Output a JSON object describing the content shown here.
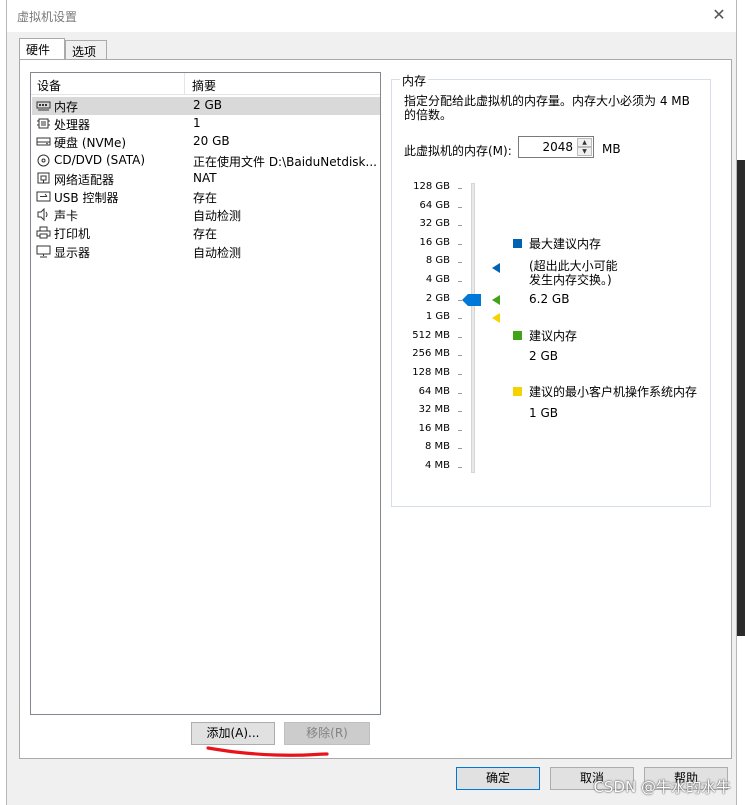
{
  "window": {
    "title": "虚拟机设置",
    "close_glyph": "✕"
  },
  "tabs": [
    {
      "label": "硬件"
    },
    {
      "label": "选项"
    }
  ],
  "device_list": {
    "headers": {
      "device": "设备",
      "summary": "摘要"
    },
    "rows": [
      {
        "name": "内存",
        "summary": "2 GB",
        "icon": "memory-icon",
        "selected": true
      },
      {
        "name": "处理器",
        "summary": "1",
        "icon": "cpu-icon"
      },
      {
        "name": "硬盘 (NVMe)",
        "summary": "20 GB",
        "icon": "hard-disk-icon"
      },
      {
        "name": "CD/DVD (SATA)",
        "summary": "正在使用文件 D:\\BaiduNetdisk...",
        "icon": "cd-dvd-icon"
      },
      {
        "name": "网络适配器",
        "summary": "NAT",
        "icon": "network-adapter-icon"
      },
      {
        "name": "USB 控制器",
        "summary": "存在",
        "icon": "usb-icon"
      },
      {
        "name": "声卡",
        "summary": "自动检测",
        "icon": "speaker-icon"
      },
      {
        "name": "打印机",
        "summary": "存在",
        "icon": "printer-icon"
      },
      {
        "name": "显示器",
        "summary": "自动检测",
        "icon": "monitor-icon"
      }
    ]
  },
  "buttons": {
    "add": "添加(A)...",
    "remove": "移除(R)",
    "ok": "确定",
    "cancel": "取消",
    "help": "帮助"
  },
  "memory": {
    "group_title": "内存",
    "description": "指定分配给此虚拟机的内存量。内存大小必须为 4 MB 的倍数。",
    "label": "此虚拟机的内存(M):",
    "value": "2048",
    "unit": "MB",
    "scale_labels": [
      "128 GB",
      "64 GB",
      "32 GB",
      "16 GB",
      "8 GB",
      "4 GB",
      "2 GB",
      "1 GB",
      "512 MB",
      "256 MB",
      "128 MB",
      "64 MB",
      "32 MB",
      "16 MB",
      "8 MB",
      "4 MB"
    ],
    "current_index": 6,
    "max_recommended_index": 4.3,
    "recommended_index": 6,
    "min_guest_index": 7,
    "legend": {
      "max_recommended": {
        "title": "最大建议内存",
        "note_line1": "(超出此大小可能",
        "note_line2": "发生内存交换。)",
        "value": "6.2 GB",
        "color": "#0063b1"
      },
      "recommended": {
        "title": "建议内存",
        "value": "2 GB",
        "color": "#41a317"
      },
      "min_guest": {
        "title": "建议的最小客户机操作系统内存",
        "value": "1 GB",
        "color": "#f5d300"
      }
    }
  },
  "watermark": "CSDN @牛水的水牛",
  "colors": {
    "annotation_stroke": "#e8141c",
    "accent": "#0078d7"
  }
}
